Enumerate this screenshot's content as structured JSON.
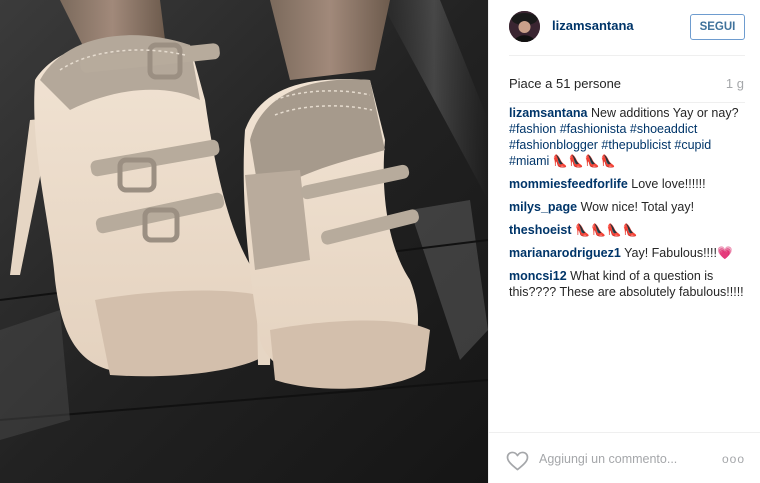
{
  "post": {
    "username": "lizamsantana",
    "follow_label": "SEGUI",
    "likes": "Piace a 51 persone",
    "age": "1 g"
  },
  "caption": {
    "username": "lizamsantana",
    "text": "New additions Yay or nay?",
    "hashtags": "#fashion #fashionista #shoeaddict #fashionblogger #thepublicist #cupid #miami",
    "emoji": "👠👠👠👠"
  },
  "comments": [
    {
      "user": "mommiesfeedforlife",
      "text": "Love love!!!!!!"
    },
    {
      "user": "milys_page",
      "text": "Wow nice! Total yay!"
    },
    {
      "user": "theshoeist",
      "text": "👠👠👠👠"
    },
    {
      "user": "marianarodriguez1",
      "text": "Yay! Fabulous!!!!💗"
    },
    {
      "user": "moncsi12",
      "text": "What kind of a question is this???? These are absolutely fabulous!!!!!"
    }
  ],
  "footer": {
    "comment_placeholder": "Aggiungi un commento...",
    "more_label": "ooo"
  },
  "icons": {
    "like": "heart-outline-icon",
    "more": "more-options-icon"
  },
  "colors": {
    "username": "#003569",
    "follow_border": "#6e9ccf",
    "follow_text": "#3f729b",
    "muted": "#a5a7aa"
  }
}
